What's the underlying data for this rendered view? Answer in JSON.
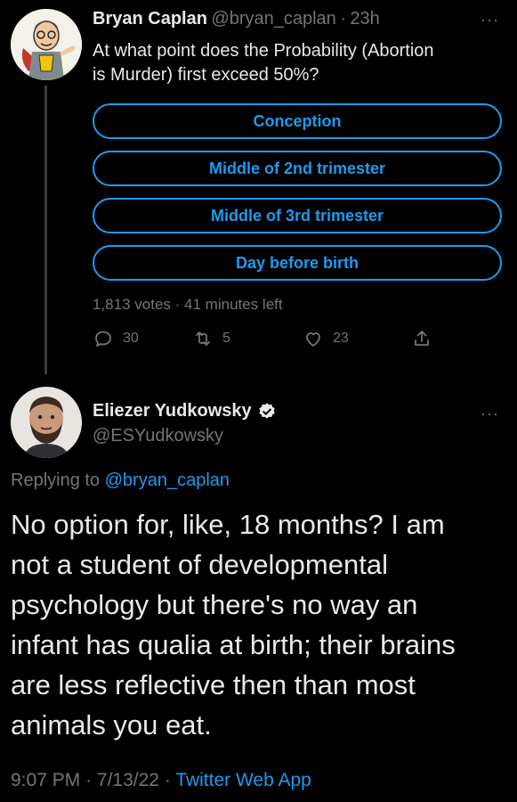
{
  "tweet1": {
    "author_name": "Bryan Caplan",
    "handle": "@bryan_caplan",
    "separator": "·",
    "time": "23h",
    "more": "···",
    "text_line1": "At what point does the Probability (Abortion",
    "text_line2": "is Murder) first exceed 50%?",
    "poll": {
      "options": [
        "Conception",
        "Middle of 2nd trimester",
        "Middle of 3rd trimester",
        "Day before birth"
      ],
      "votes": "1,813 votes",
      "separator": "·",
      "time_left": "41 minutes left"
    },
    "actions": {
      "replies": "30",
      "retweets": "5",
      "likes": "23"
    }
  },
  "tweet2": {
    "author_name": "Eliezer Yudkowsky",
    "handle": "@ESYudkowsky",
    "more": "···",
    "replying_prefix": "Replying to",
    "replying_to": "@bryan_caplan",
    "text_lines": [
      "No option for, like, 18 months?  I am",
      "not a student of developmental",
      "psychology but there's no way an",
      "infant has qualia at birth; their brains",
      "are less reflective then than most",
      "animals you eat."
    ],
    "time": "9:07 PM",
    "date": "7/13/22",
    "separator": "·",
    "source": "Twitter Web App"
  },
  "colors": {
    "accent": "#1d9bf0",
    "muted": "#71767b",
    "background": "#000000",
    "text": "#e7e9ea"
  },
  "icons": [
    "reply-icon",
    "retweet-icon",
    "like-icon",
    "share-icon",
    "verified-badge-icon"
  ]
}
